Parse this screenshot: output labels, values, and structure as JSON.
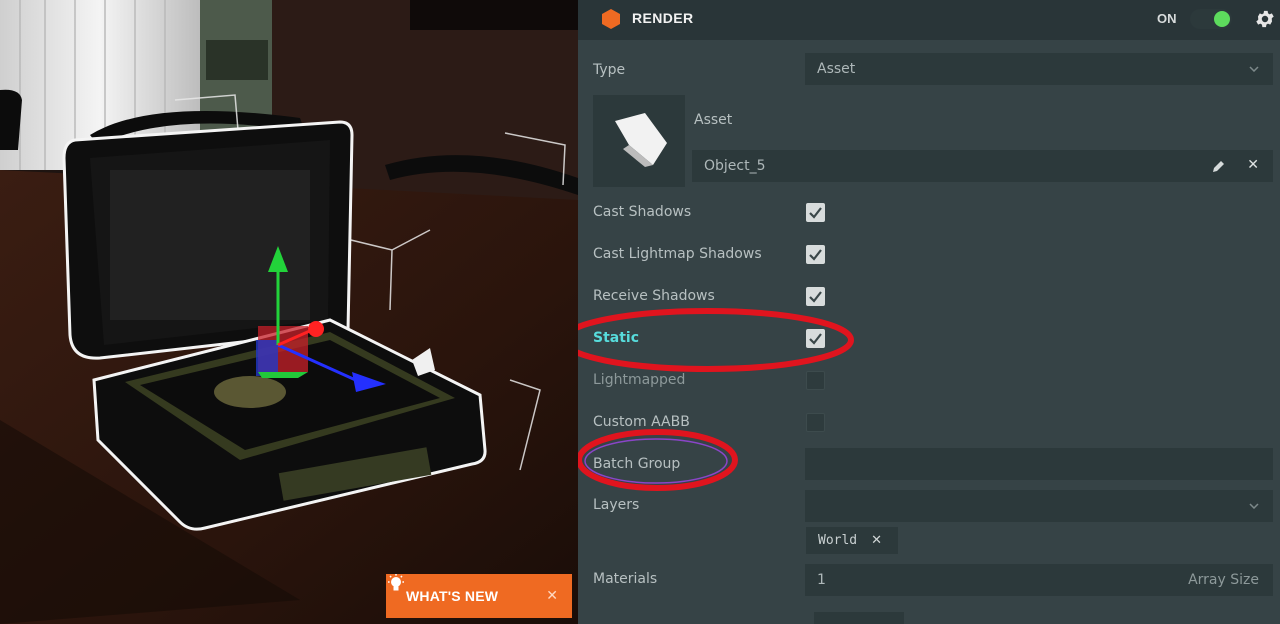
{
  "panel": {
    "title": "RENDER",
    "toggle_label": "ON",
    "toggle_on": true,
    "type": {
      "label": "Type",
      "value": "Asset"
    },
    "asset": {
      "label": "Asset",
      "value": "Object_5"
    },
    "checkboxes": [
      {
        "label": "Cast Shadows",
        "checked": true
      },
      {
        "label": "Cast Lightmap Shadows",
        "checked": true
      },
      {
        "label": "Receive Shadows",
        "checked": true
      },
      {
        "label": "Static",
        "checked": true
      },
      {
        "label": "Lightmapped",
        "checked": false
      },
      {
        "label": "Custom AABB",
        "checked": false
      }
    ],
    "batch_group": {
      "label": "Batch Group",
      "value": ""
    },
    "layers": {
      "label": "Layers",
      "value": "",
      "chip": "World"
    },
    "materials": {
      "label": "Materials",
      "value": "1",
      "suffix": "Array Size"
    }
  },
  "whats_new": {
    "label": "WHAT'S NEW"
  },
  "colors": {
    "accent_orange": "#ef6a22",
    "toggle_green": "#5ddb5d",
    "static_label": "#57dcdc",
    "annotation_red": "#e0141e"
  },
  "icons": [
    "render-icon",
    "gear-icon",
    "chevron-down-icon",
    "pencil-icon",
    "close-icon",
    "check-icon",
    "lightbulb-icon"
  ]
}
